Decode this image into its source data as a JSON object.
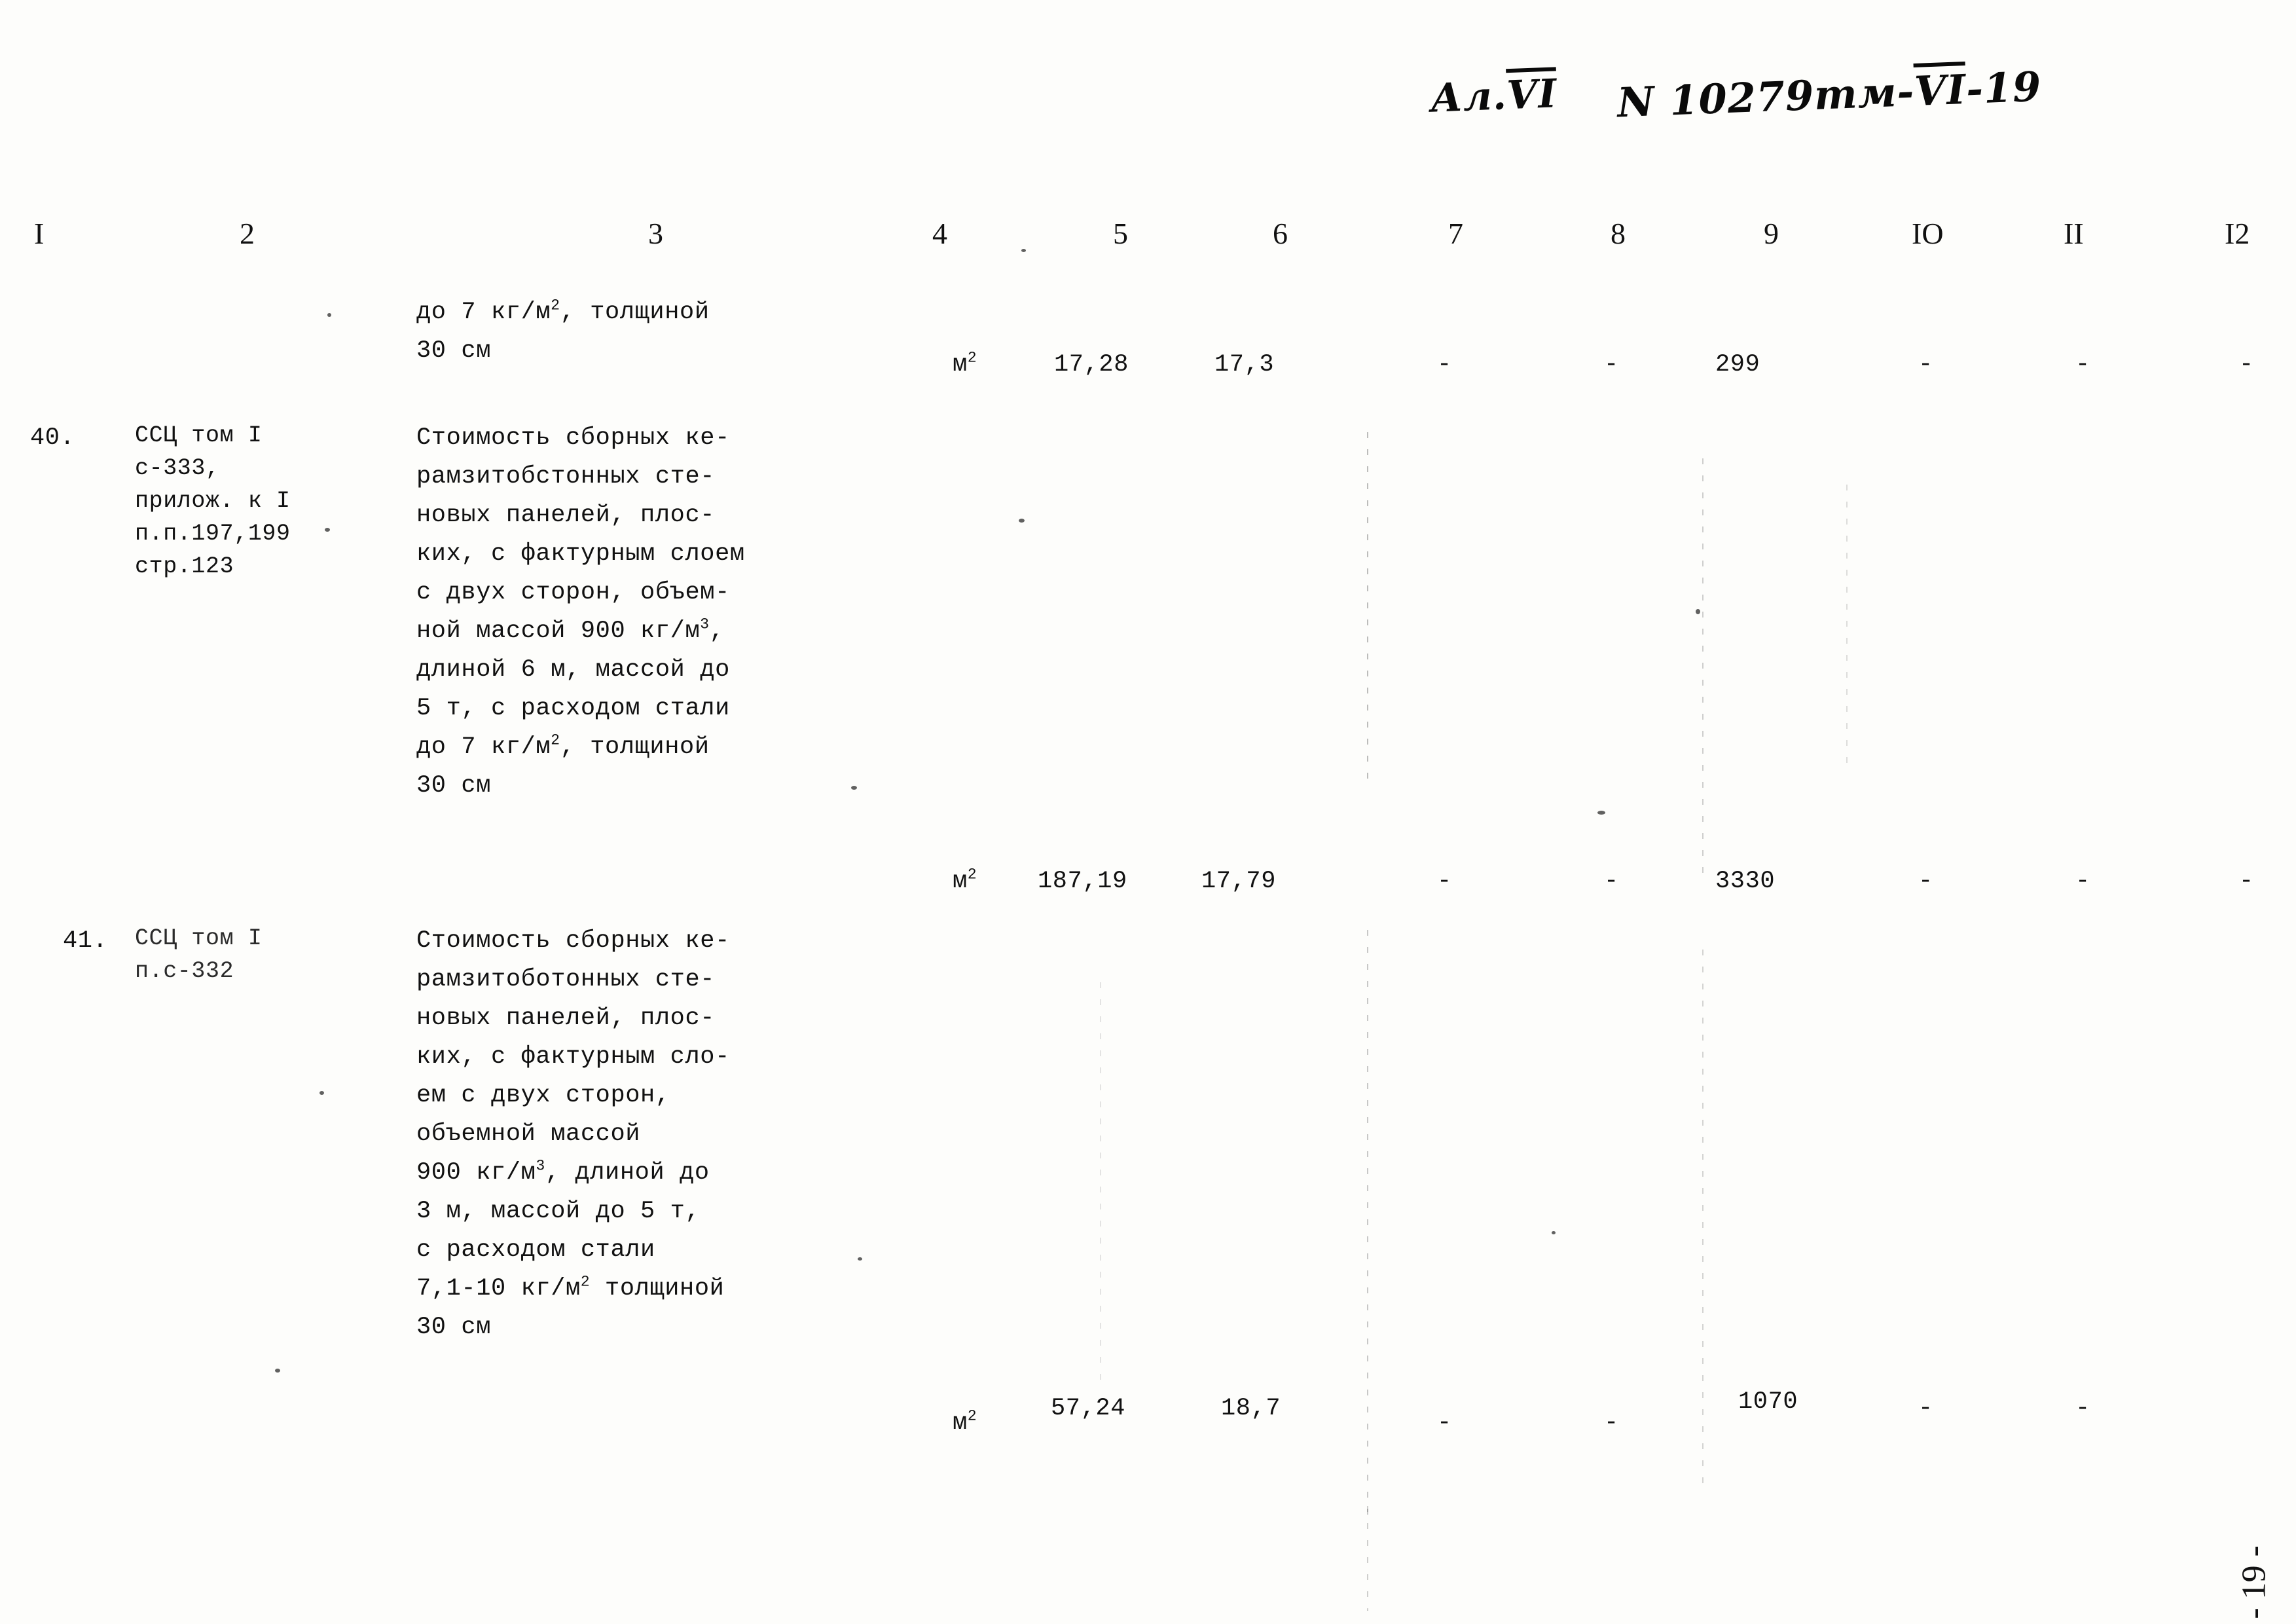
{
  "document": {
    "handwritten_album": "Ал. VI",
    "handwritten_code": "N 10279тм-VI-19",
    "page_folio": "- 19 -"
  },
  "table": {
    "column_headers": [
      "I",
      "2",
      "3",
      "4",
      "5",
      "6",
      "7",
      "8",
      "9",
      "IO",
      "II",
      "I2"
    ],
    "continued_row": {
      "description_lines": [
        "до 7 кг/м<sup>2</sup>, толщиной",
        "30 см"
      ],
      "unit": "м<sup>2</sup>",
      "col5": "17,28",
      "col6": "17,3",
      "col7": "-",
      "col8": "-",
      "col9": "299",
      "col10": "-",
      "col11": "-",
      "col12": "-"
    },
    "rows": [
      {
        "number": "40.",
        "reference_lines": [
          "ССЦ том I",
          "с-333,",
          "прилож. к I",
          "п.п.197,199",
          "стр.123"
        ],
        "description_lines": [
          "Стоимость сборных ке-",
          "рамзитобстонных сте-",
          "новых панелей, плос-",
          "ких, с фактурным слоем",
          "с двух сторон, объем-",
          "ной массой 900 кг/м<sup>3</sup>,",
          "длиной 6 м, массой до",
          "5 т, с расходом стали",
          "до 7 кг/м<sup>2</sup>, толщиной",
          "30 см"
        ],
        "unit": "м<sup>2</sup>",
        "col5": "187,19",
        "col6": "17,79",
        "col7": "-",
        "col8": "-",
        "col9": "3330",
        "col10": "-",
        "col11": "-",
        "col12": "-"
      },
      {
        "number": "41.",
        "reference_lines": [
          "ССЦ том I",
          "п.с-332"
        ],
        "description_lines": [
          "Стоимость сборных ке-",
          "рамзитоботонных сте-",
          "новых панелей, плос-",
          "ких, с фактурным сло-",
          "ем с двух сторон,",
          "объемной массой",
          "900 кг/м<sup>3</sup>, длиной до",
          "3 м, массой до 5 т,",
          "с расходом стали",
          "7,1-10 кг/м<sup>2</sup> толщиной",
          "30 см"
        ],
        "unit": "м<sup>2</sup>",
        "col5": "57,24",
        "col6": "18,7",
        "col7": "-",
        "col8": "-",
        "col9": "1070",
        "col10": "-",
        "col11": "-",
        "col12": "-"
      }
    ]
  }
}
